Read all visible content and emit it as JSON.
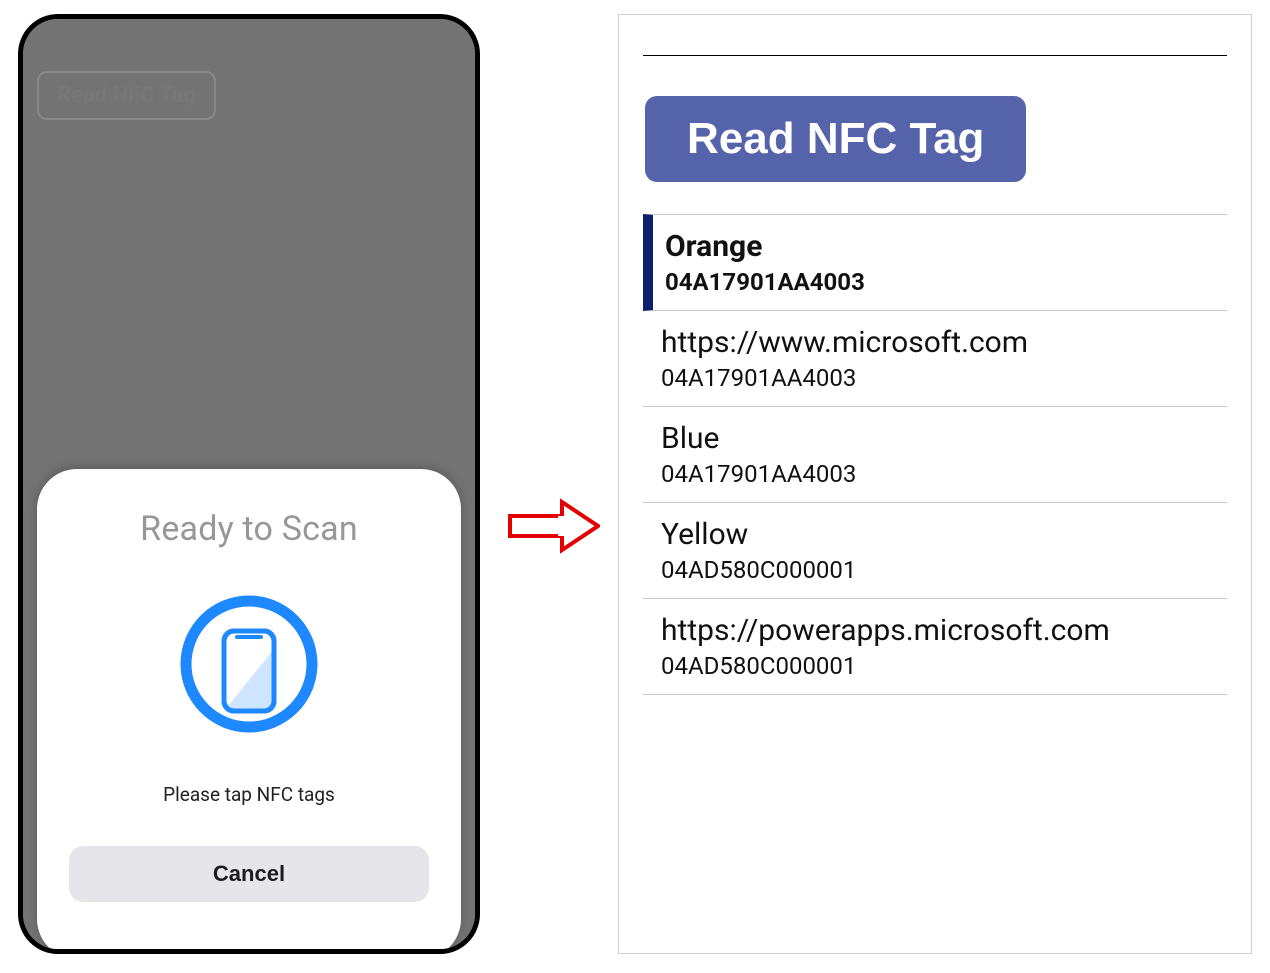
{
  "phone": {
    "back_button_label": "Read NFC Tag",
    "sheet": {
      "title": "Ready to Scan",
      "subtitle": "Please tap NFC tags",
      "cancel_label": "Cancel"
    }
  },
  "panel": {
    "button_label": "Read NFC Tag",
    "items": [
      {
        "title": "Orange",
        "tag": "04A17901AA4003",
        "selected": true
      },
      {
        "title": "https://www.microsoft.com",
        "tag": "04A17901AA4003",
        "selected": false
      },
      {
        "title": "Blue",
        "tag": "04A17901AA4003",
        "selected": false
      },
      {
        "title": "Yellow",
        "tag": "04AD580C000001",
        "selected": false
      },
      {
        "title": "https://powerapps.microsoft.com",
        "tag": "04AD580C000001",
        "selected": false
      }
    ]
  }
}
